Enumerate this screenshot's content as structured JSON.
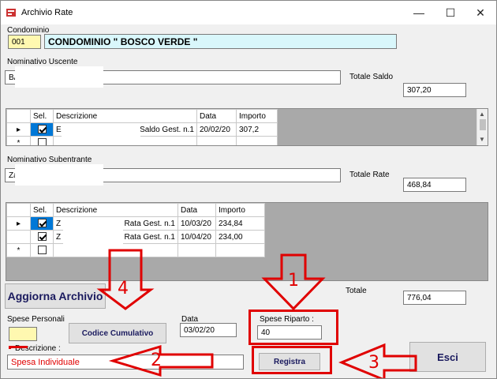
{
  "window": {
    "title": "Archivio Rate",
    "minimize": "—",
    "maximize": "☐",
    "close": "✕"
  },
  "condominio": {
    "label": "Condominio",
    "code": "001",
    "name": "CONDOMINIO \" BOSCO VERDE \""
  },
  "uscente": {
    "label": "Nominativo Uscente",
    "value": "BA",
    "totale_label": "Totale Saldo",
    "totale_value": "307,20",
    "grid": {
      "headers": [
        "Sel.",
        "Descrizione",
        "Data",
        "Importo"
      ],
      "rows": [
        {
          "marker": "▸",
          "checked": true,
          "name": "E",
          "desc": "Saldo Gest. n.1",
          "date": "20/02/20",
          "amount": "307,2"
        },
        {
          "marker": "*",
          "checked": false,
          "name": "",
          "desc": "",
          "date": "",
          "amount": ""
        }
      ]
    }
  },
  "subentrante": {
    "label": "Nominativo Subentrante",
    "value": "Za",
    "totale_label": "Totale Rate",
    "totale_value": "468,84",
    "grid": {
      "headers": [
        "Sel.",
        "Descrizione",
        "Data",
        "Importo"
      ],
      "rows": [
        {
          "marker": "▸",
          "checked": true,
          "name": "Z",
          "desc": "Rata Gest. n.1",
          "date": "10/03/20",
          "amount": "234,84"
        },
        {
          "marker": "",
          "checked": true,
          "name": "Z",
          "desc": "Rata Gest. n.1",
          "date": "10/04/20",
          "amount": "234,00"
        },
        {
          "marker": "*",
          "checked": false,
          "name": "",
          "desc": "",
          "date": "",
          "amount": ""
        }
      ]
    }
  },
  "aggiorna_label": "Aggiorna Archivio",
  "totale": {
    "label": "Totale",
    "value": "776,04"
  },
  "spese_personali": {
    "label": "Spese Personali",
    "value": ""
  },
  "codice_cumulativo_label": "Codice Cumulativo",
  "data": {
    "label": "Data",
    "value": "03/02/20"
  },
  "spese_riparto": {
    "label": "Spese Riparto :",
    "value": "40"
  },
  "descrizione": {
    "label": "Descrizione :",
    "value": "Spesa Individuale"
  },
  "registra_label": "Registra",
  "esci_label": "Esci",
  "annotations": [
    "1",
    "2",
    "3",
    "4"
  ],
  "colors": {
    "annotation": "#e00000",
    "selection": "#0078d7",
    "code_bg": "#fff8b0",
    "name_bg": "#d9f7fb"
  }
}
